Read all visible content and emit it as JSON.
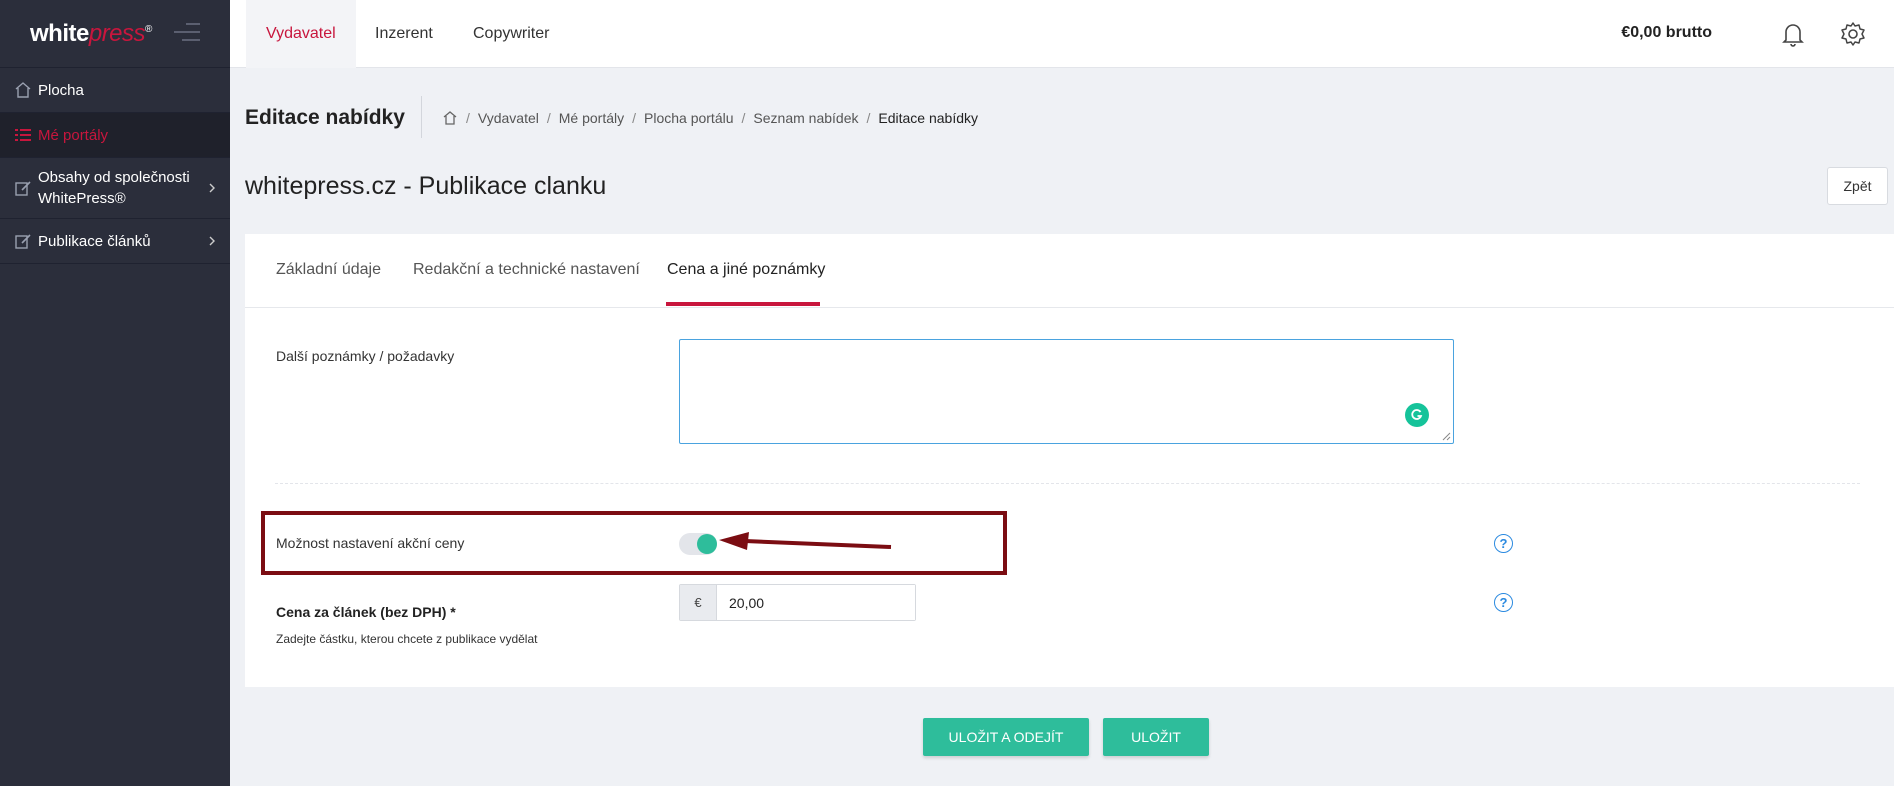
{
  "colors": {
    "brand": "#c8163d",
    "accent": "#2ebd9b",
    "sidebar": "#2b2e3b",
    "highlight": "#7b0d12",
    "help": "#2b8ae0"
  },
  "logo": {
    "white": "white",
    "press": "press",
    "reg": "®"
  },
  "sidebar": {
    "items": [
      {
        "label": "Plocha",
        "icon": "home-icon"
      },
      {
        "label": "Mé portály",
        "icon": "list-icon"
      },
      {
        "label_line1": "Obsahy od společnosti",
        "label_line2": "WhitePress®",
        "icon": "edit-icon"
      },
      {
        "label": "Publikace článků",
        "icon": "edit-icon"
      }
    ]
  },
  "topbar": {
    "tabs": [
      "Vydavatel",
      "Inzerent",
      "Copywriter"
    ],
    "balance": "€0,00 brutto"
  },
  "header": {
    "title": "Editace nabídky",
    "breadcrumb": [
      "Vydavatel",
      "Mé portály",
      "Plocha portálu",
      "Seznam nabídek",
      "Editace nabídky"
    ],
    "subtitle": "whitepress.cz - Publikace clanku",
    "back_label": "Zpět"
  },
  "tabs": [
    "Základní údaje",
    "Redakční a technické nastavení",
    "Cena a jiné poznámky"
  ],
  "form": {
    "notes_label": "Další poznámky / požadavky",
    "notes_value": "",
    "promo_label": "Možnost nastavení akční ceny",
    "promo_enabled": true,
    "price_label": "Cena za článek (bez DPH) *",
    "price_hint": "Zadejte částku, kterou chcete z publikace vydělat",
    "currency": "€",
    "price_value": "20,00",
    "help_glyph": "?"
  },
  "buttons": {
    "save_exit": "ULOŽIT A ODEJÍT",
    "save": "ULOŽIT"
  }
}
